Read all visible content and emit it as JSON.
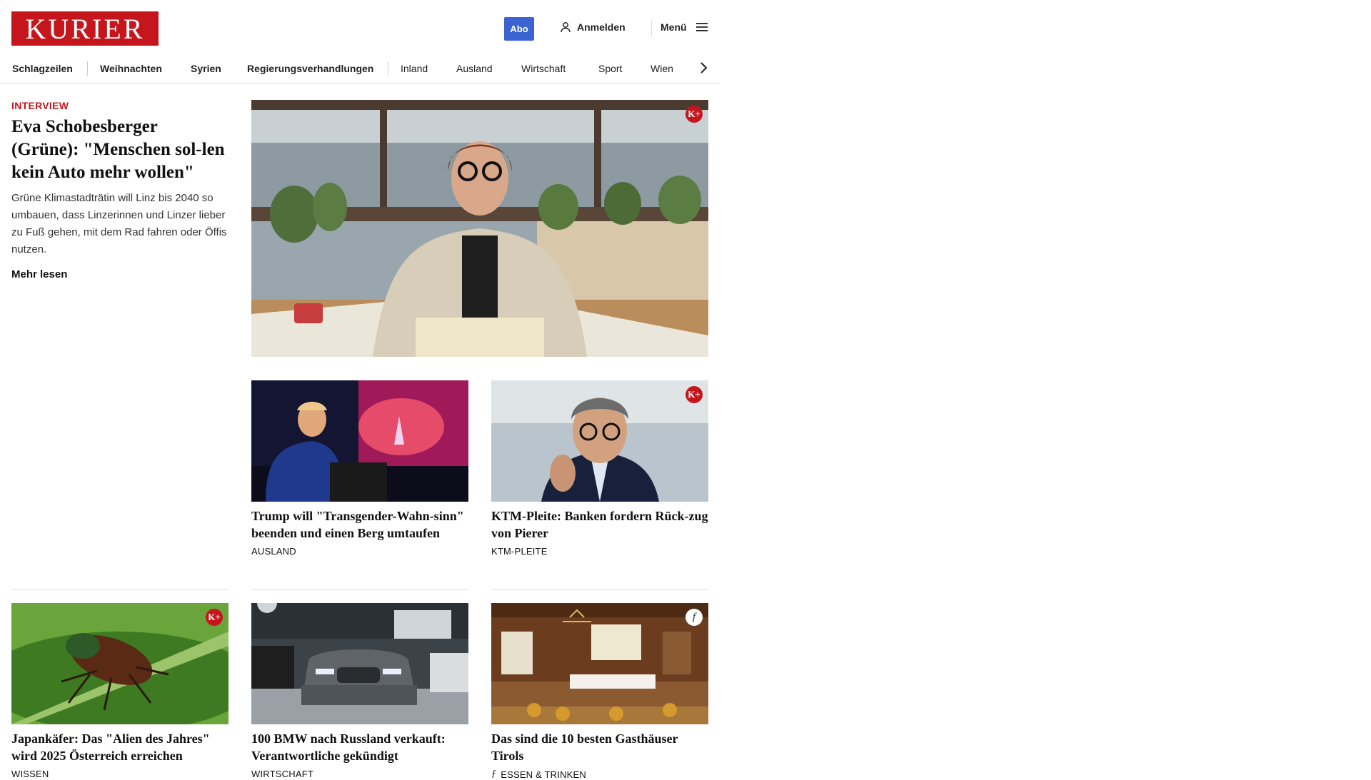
{
  "header": {
    "logo_text": "KURIER",
    "abo_label": "Abo",
    "login_label": "Anmelden",
    "menu_label": "Menü"
  },
  "nav": {
    "items": [
      "Schlagzeilen",
      "Weihnachten",
      "Syrien",
      "Regierungsverhandlungen",
      "Inland",
      "Ausland",
      "Wirtschaft",
      "Sport",
      "Wien"
    ]
  },
  "lead": {
    "kicker": "INTERVIEW",
    "title": "Eva Schobesberger (Grüne): \"Menschen sol-len kein Auto mehr wollen\"",
    "teaser": "Grüne Klimastadträtin will Linz bis 2040 so umbauen, dass Linzerinnen und Linzer lieber zu Fuß gehen, mit dem Rad fahren oder Öffis nutzen.",
    "more_label": "Mehr lesen",
    "badge": "K+"
  },
  "cards": [
    {
      "title": "Trump will \"Transgender-Wahn-sinn\" beenden und einen Berg umtaufen",
      "category": "AUSLAND",
      "badge": ""
    },
    {
      "title": "KTM-Pleite: Banken fordern Rück-zug von Pierer",
      "category": "KTM-PLEITE",
      "badge": "K+"
    },
    {
      "title": "Japankäfer: Das \"Alien des Jahres\" wird 2025 Österreich erreichen",
      "category": "WISSEN",
      "badge": "K+"
    },
    {
      "title": "100 BMW nach Russland verkauft: Verantwortliche gekündigt",
      "category": "WIRTSCHAFT",
      "badge": ""
    },
    {
      "title": "Das sind die 10 besten Gasthäuser Tirols",
      "category": "ESSEN & TRINKEN",
      "badge": "f"
    }
  ],
  "icons": {
    "login": "user-icon",
    "menu": "hamburger-menu-icon",
    "nav_next": "chevron-right-icon",
    "premium": "kurier-plus-badge-icon",
    "freizeit": "freizeit-f-icon"
  },
  "colors": {
    "brand_red": "#c4161c",
    "abo_blue": "#3b63d1"
  }
}
